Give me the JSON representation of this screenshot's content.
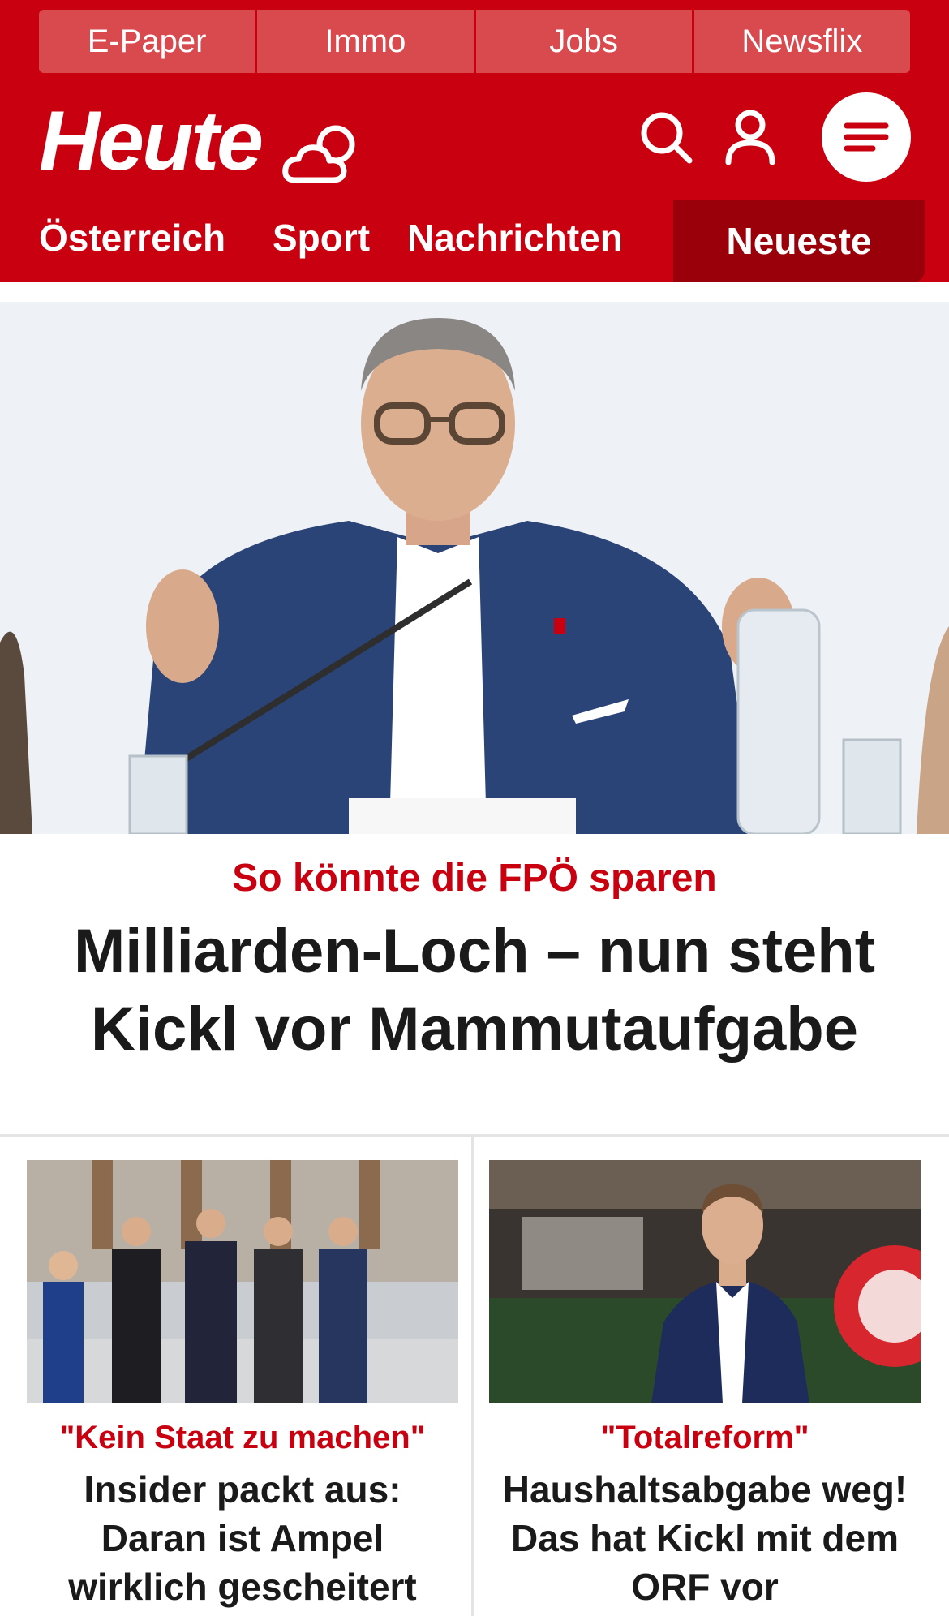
{
  "top_links": [
    "E-Paper",
    "Immo",
    "Jobs",
    "Newsflix"
  ],
  "brand": {
    "logo_text": "Heute"
  },
  "icons": {
    "weather": "cloud-sun-icon",
    "search": "search-icon",
    "account": "user-icon",
    "menu": "menu-icon"
  },
  "nav": {
    "items": [
      "Österreich",
      "Sport",
      "Nachrichten"
    ],
    "highlight": "Neueste"
  },
  "colors": {
    "brand_red": "#c8000f",
    "dark_red": "#9a0009",
    "text": "#1a1a1a"
  },
  "hero": {
    "kicker": "So könnte die FPÖ sparen",
    "headline": "Milliarden-Loch – nun steht Kickl vor Mammutaufgabe"
  },
  "teasers": [
    {
      "kicker": "\"Kein Staat zu machen\"",
      "title": "Insider packt aus: Daran ist Ampel wirklich gescheitert"
    },
    {
      "kicker": "\"Totalreform\"",
      "title": "Haushaltsabgabe weg! Das hat Kickl mit dem ORF vor"
    }
  ]
}
